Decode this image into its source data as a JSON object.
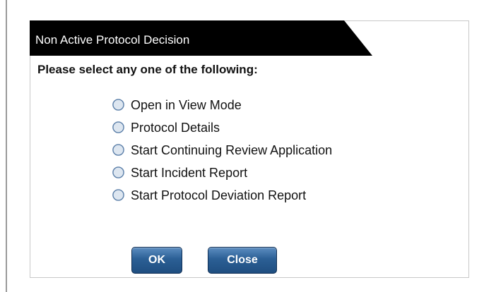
{
  "dialog": {
    "title": "Non Active Protocol Decision",
    "prompt": "Please select any one of the following:",
    "options": [
      {
        "label": "Open in View Mode",
        "selected": false
      },
      {
        "label": "Protocol Details",
        "selected": false
      },
      {
        "label": "Start Continuing Review Application",
        "selected": false
      },
      {
        "label": "Start Incident Report",
        "selected": false
      },
      {
        "label": "Start Protocol Deviation Report",
        "selected": false
      }
    ],
    "buttons": {
      "ok_label": "OK",
      "close_label": "Close"
    }
  },
  "colors": {
    "title_bg": "#000000",
    "title_text": "#ffffff",
    "button_bg": "#2b5f95",
    "radio_fill": "#dde6f0",
    "radio_border": "#5a7ea8"
  },
  "icons": {
    "radio": "radio-button-icon"
  }
}
